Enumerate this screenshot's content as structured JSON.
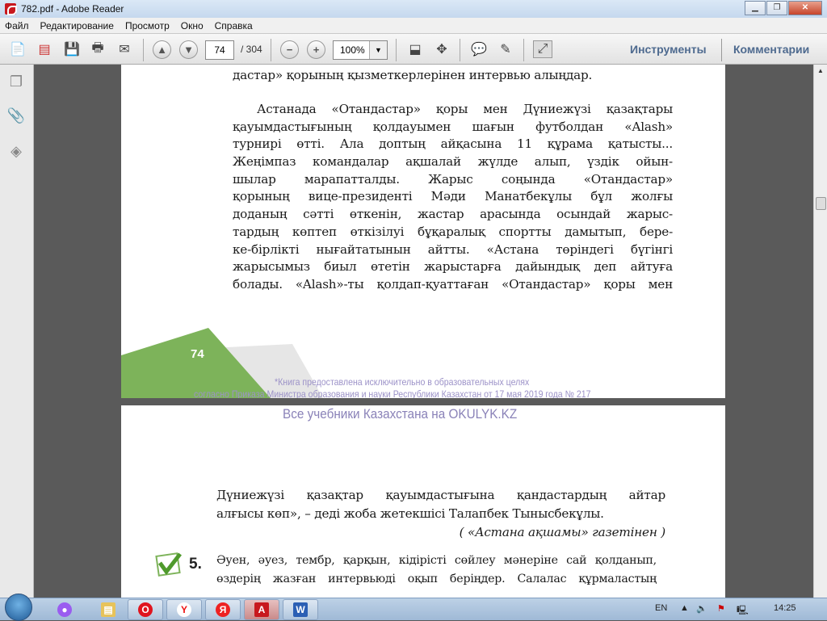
{
  "window": {
    "title": "782.pdf - Adobe Reader"
  },
  "menu": [
    "Файл",
    "Редактирование",
    "Просмотр",
    "Окно",
    "Справка"
  ],
  "toolbar": {
    "current_page": "74",
    "total_pages": "/ 304",
    "zoom": "100%",
    "tools_label": "Инструменты",
    "comments_label": "Комментарии"
  },
  "page1": {
    "top_line": "дастар» қорының қызметкерлерінен интервью алыңдар.",
    "paragraph": [
      "Астанада «Отандастар» қоры мен Дүниежүзі қазақтары",
      "қауымдастығының қолдауымен шағын футболдан «Alash»",
      "турнирі өтті. Ала доптың айқасына 11 құрама қатысты...",
      "Жеңімпаз командалар ақшалай жүлде алып, үздік ойын-",
      "шылар марапатталды. Жарыс соңында «Отандастар»",
      "қорының вице-президенті Мәди Манатбекұлы бұл жолғы",
      "доданың сәтті өткенін, жастар арасында осындай жарыс-",
      "тардың көптеп өткізілуі бұқаралық спортты дамытып, бере-",
      "ке-бірлікті нығайтатынын айтты. «Астана төріндегі бүгінгі",
      "жарысымыз биыл өтетін жарыстарға дайындық деп айтуға",
      "болады. «Alash»-ты қолдап-қуаттаған «Отандастар» қоры мен"
    ],
    "page_number": "74",
    "watermark_line1": "*Книга предоставлена исключительно в образовательных целях",
    "watermark_line2": "согласно Приказа Министра образования и науки Республики Казахстан от 17 мая 2019 года № 217"
  },
  "page2": {
    "watermark": "Все учебники Казахстана на OKULYK.KZ",
    "lines": [
      "Дүниежүзі қазақтар қауымдастығына қандастардың айтар",
      "алғысы көп», – деді жоба жетекшісі Талапбек Тынысбекұлы."
    ],
    "source": "( «Астана ақшамы» газетінен )",
    "task_number": "5.",
    "task_lines": [
      "Әуен, әуез, тембр, қарқын, кідірісті сөйлеу мәнеріне сай қолданып,",
      "өздерің жазған интервьюді оқып беріңдер. Салалас құрмаластың"
    ]
  },
  "taskbar": {
    "language": "EN",
    "time": "14:25"
  },
  "colors": {
    "accent_green": "#7db35a",
    "watermark": "#9c92c8",
    "toolbar_text": "#4e6a8f"
  }
}
